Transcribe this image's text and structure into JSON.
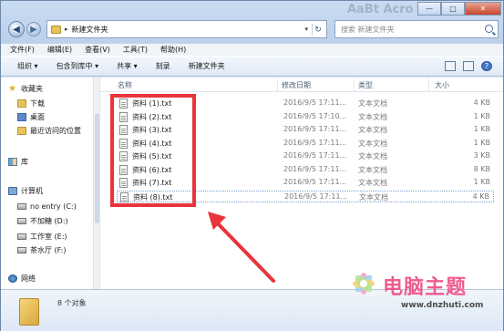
{
  "window": {
    "title_ghost": "AaBt Acro",
    "controls": [
      "—",
      "□",
      "✕"
    ]
  },
  "address_bar": {
    "path_separator": "▸",
    "path": "新建文件夹",
    "dropdown": "▾",
    "refresh": "↻"
  },
  "search": {
    "placeholder": "搜索 新建文件夹"
  },
  "menubar": {
    "items": [
      "文件(F)",
      "编辑(E)",
      "查看(V)",
      "工具(T)",
      "帮助(H)"
    ]
  },
  "toolbar": {
    "organize": "组织 ▾",
    "include_in_library": "包含到库中 ▾",
    "share": "共享 ▾",
    "burn": "刻录",
    "new_folder": "新建文件夹",
    "view_icon": "view-options-icon",
    "help_icon_glyph": "?"
  },
  "navpane": {
    "favorites": {
      "label": "收藏夹",
      "icon": "star-icon"
    },
    "downloads": {
      "label": "下载",
      "icon": "folder-icon"
    },
    "desktop": {
      "label": "桌面",
      "icon": "desktop-icon"
    },
    "recent": {
      "label": "最近访问的位置",
      "icon": "recent-places-icon"
    },
    "libraries": {
      "label": "库",
      "icon": "library-icon"
    },
    "computer": {
      "label": "计算机",
      "icon": "computer-icon"
    },
    "drive_c": {
      "label": "no entry (C:)",
      "icon": "drive-icon"
    },
    "drive_d": {
      "label": "不加糖 (D:)",
      "icon": "drive-icon"
    },
    "drive_e": {
      "label": "工作室 (E:)",
      "icon": "drive-icon"
    },
    "drive_f": {
      "label": "茶水厅 (F:)",
      "icon": "drive-icon"
    },
    "network": {
      "label": "网络",
      "icon": "network-icon"
    }
  },
  "filelist": {
    "columns": {
      "name": "名称",
      "modified": "修改日期",
      "type": "类型",
      "size": "大小"
    },
    "rows": [
      {
        "name": "资料 (1).txt",
        "modified": "2016/9/5 17:11...",
        "type": "文本文档",
        "size": "4 KB"
      },
      {
        "name": "资料 (2).txt",
        "modified": "2016/9/5 17:10...",
        "type": "文本文档",
        "size": "1 KB"
      },
      {
        "name": "资料 (3).txt",
        "modified": "2016/9/5 17:11...",
        "type": "文本文档",
        "size": "1 KB"
      },
      {
        "name": "资料 (4).txt",
        "modified": "2016/9/5 17:11...",
        "type": "文本文档",
        "size": "1 KB"
      },
      {
        "name": "资料 (5).txt",
        "modified": "2016/9/5 17:11...",
        "type": "文本文档",
        "size": "3 KB"
      },
      {
        "name": "资料 (6).txt",
        "modified": "2016/9/5 17:11...",
        "type": "文本文档",
        "size": "8 KB"
      },
      {
        "name": "资料 (7).txt",
        "modified": "2016/9/5 17:11...",
        "type": "文本文档",
        "size": "1 KB"
      },
      {
        "name": "资料 (8).txt",
        "modified": "2016/9/5 17:11...",
        "type": "文本文档",
        "size": "4 KB"
      }
    ]
  },
  "details": {
    "count": "8 个对象"
  },
  "watermark": {
    "title": "电脑主题",
    "url": "www.dnzhuti.com"
  },
  "colors": {
    "annotation_red": "#e8343a",
    "watermark_pink": "#ef5b8f"
  }
}
